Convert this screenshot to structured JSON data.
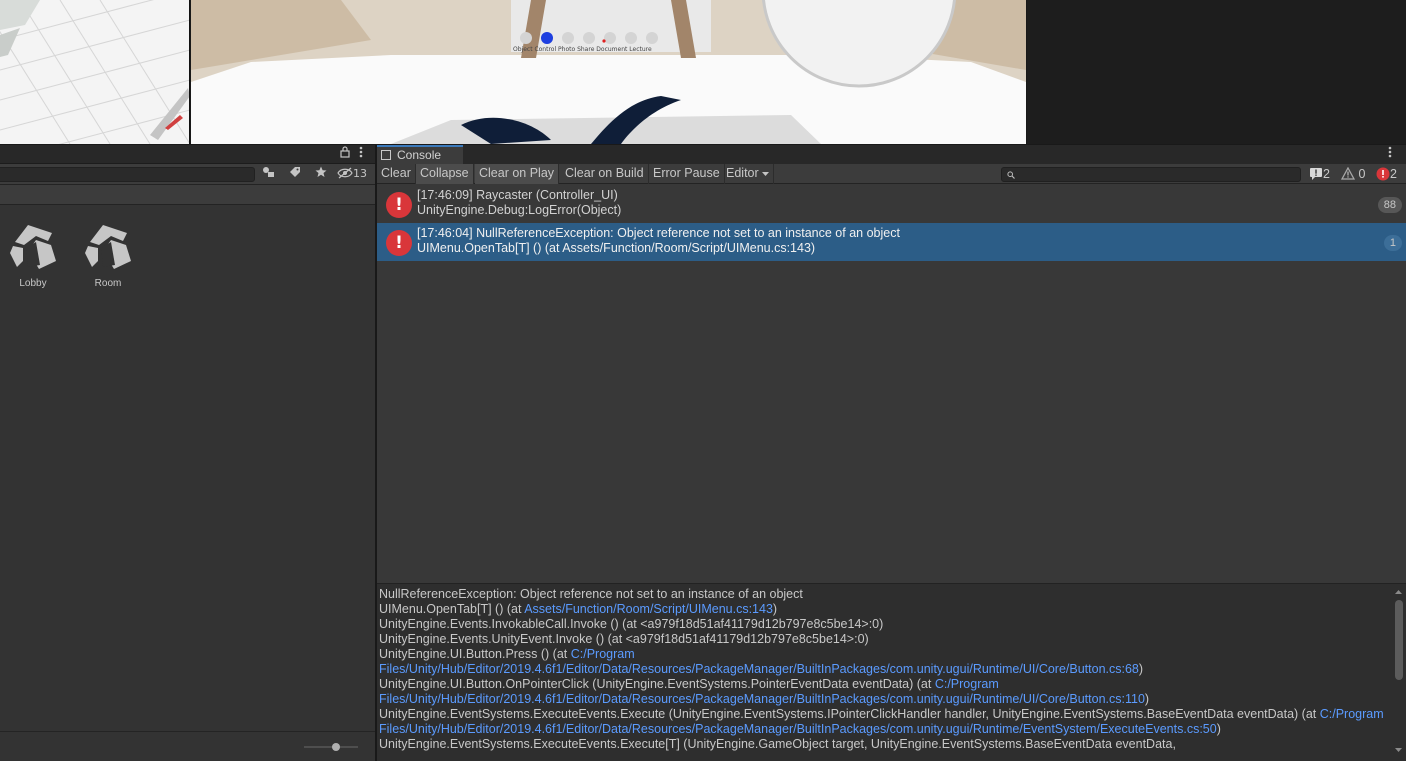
{
  "game_view": {
    "toolbar_caption": "Object Control Photo Share Document Lecture"
  },
  "project": {
    "hidden_count": "13",
    "assets": [
      {
        "label": "Lobby"
      },
      {
        "label": "Room"
      }
    ]
  },
  "console": {
    "tab_title": "Console",
    "toolbar": {
      "clear": "Clear",
      "collapse": "Collapse",
      "clear_on_play": "Clear on Play",
      "clear_on_build": "Clear on Build",
      "error_pause": "Error Pause",
      "editor": "Editor",
      "search_value": "",
      "info_count": "2",
      "warning_count": "0",
      "error_count": "2"
    },
    "entries": [
      {
        "line1": "[17:46:09] Raycaster (Controller_UI)",
        "line2": "UnityEngine.Debug:LogError(Object)",
        "count": "88",
        "selected": false
      },
      {
        "line1": "[17:46:04] NullReferenceException: Object reference not set to an instance of an object",
        "line2": "UIMenu.OpenTab[T] () (at Assets/Function/Room/Script/UIMenu.cs:143)",
        "count": "1",
        "selected": true
      }
    ],
    "detail": {
      "l1": "NullReferenceException: Object reference not set to an instance of an object",
      "l2a": "UIMenu.OpenTab[T] () (at ",
      "l2b": "Assets/Function/Room/Script/UIMenu.cs:143",
      "l2c": ")",
      "l3": "UnityEngine.Events.InvokableCall.Invoke () (at <a979f18d51af41179d12b797e8c5be14>:0)",
      "l4": "UnityEngine.Events.UnityEvent.Invoke () (at <a979f18d51af41179d12b797e8c5be14>:0)",
      "l5a": "UnityEngine.UI.Button.Press () (at ",
      "l5b": "C:/Program",
      "l6a": "Files/Unity/Hub/Editor/2019.4.6f1/Editor/Data/Resources/PackageManager/BuiltInPackages/com.unity.ugui/Runtime/UI/Core/Button.cs:68",
      "l6b": ")",
      "l7a": "UnityEngine.UI.Button.OnPointerClick (UnityEngine.EventSystems.PointerEventData eventData) (at ",
      "l7b": "C:/Program",
      "l8a": "Files/Unity/Hub/Editor/2019.4.6f1/Editor/Data/Resources/PackageManager/BuiltInPackages/com.unity.ugui/Runtime/UI/Core/Button.cs:110",
      "l8b": ")",
      "l9a": "UnityEngine.EventSystems.ExecuteEvents.Execute (UnityEngine.EventSystems.IPointerClickHandler handler, UnityEngine.EventSystems.BaseEventData eventData) (at ",
      "l9b": "C:/Program",
      "l10a": "Files/Unity/Hub/Editor/2019.4.6f1/Editor/Data/Resources/PackageManager/BuiltInPackages/com.unity.ugui/Runtime/EventSystem/ExecuteEvents.cs:50",
      "l10b": ")",
      "l11": "UnityEngine.EventSystems.ExecuteEvents.Execute[T] (UnityEngine.GameObject target, UnityEngine.EventSystems.BaseEventData eventData,"
    }
  }
}
